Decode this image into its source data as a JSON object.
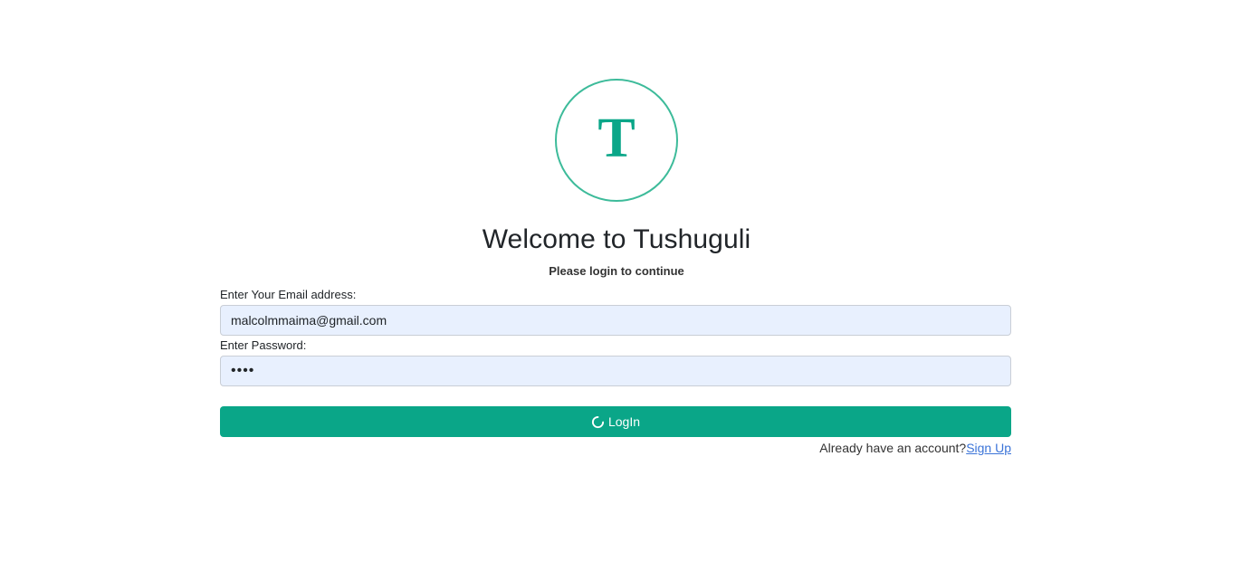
{
  "logo": {
    "letter": "T",
    "accent": "#0aa688",
    "ring_color": "#3dbb9a"
  },
  "header": {
    "title": "Welcome to Tushuguli",
    "subtitle": "Please login to continue"
  },
  "form": {
    "email_label": "Enter Your Email address:",
    "email_value": "malcolmmaima@gmail.com",
    "password_label": "Enter Password:",
    "password_value": "••••",
    "login_label": "LogIn",
    "login_icon": "spinner-icon",
    "button_color": "#0aa688",
    "input_background": "#e8f0fe"
  },
  "footer": {
    "prompt": "Already have an account?",
    "signup_label": "Sign Up",
    "link_color": "#3b74d8"
  }
}
